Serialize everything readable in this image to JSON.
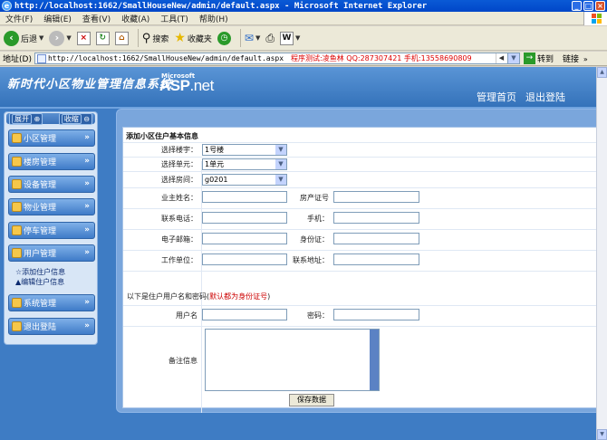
{
  "window": {
    "title": "http://localhost:1662/SmallHouseNew/admin/default.aspx - Microsoft Internet Explorer"
  },
  "menubar": [
    "文件(F)",
    "编辑(E)",
    "查看(V)",
    "收藏(A)",
    "工具(T)",
    "帮助(H)"
  ],
  "toolbar": {
    "back_label": "后退",
    "search_label": "搜索",
    "favorites_label": "收藏夹"
  },
  "address": {
    "label": "地址(D)",
    "url": "http://localhost:1662/SmallHouseNew/admin/default.aspx",
    "extra": "程序测试:凌鱼林 QQ:287307421 手机:13558690809",
    "go_label": "转到",
    "links_label": "链接"
  },
  "site": {
    "name": "新时代小区物业管理信息系统",
    "ms": "Microsoft",
    "asp": "ASP",
    "net": ".net",
    "nav": [
      "管理首页",
      "退出登陆"
    ]
  },
  "sidebar": {
    "expand_label": "展开",
    "collapse_label": "收缩",
    "items": [
      {
        "label": "小区管理"
      },
      {
        "label": "楼房管理"
      },
      {
        "label": "设备管理"
      },
      {
        "label": "物业管理"
      },
      {
        "label": "停车管理"
      },
      {
        "label": "用户管理"
      }
    ],
    "submenu": [
      "☆添加住户信息",
      "▲编辑住户信息"
    ],
    "items2": [
      {
        "label": "系统管理"
      },
      {
        "label": "退出登陆"
      }
    ]
  },
  "form": {
    "title": "添加小区住户基本信息",
    "building_label": "选择楼宇：",
    "building_value": "1号楼",
    "unit_label": "选择单元：",
    "unit_value": "1单元",
    "room_label": "选择房间：",
    "room_value": "g0201",
    "owner_label": "业主姓名：",
    "cert_label": "房产证号",
    "phone_label": "联系电话：",
    "mobile_label": "手机：",
    "email_label": "电子邮箱：",
    "id_label": "身份证：",
    "work_label": "工作单位：",
    "address_label": "联系地址：",
    "note_prefix": "以下是住户用户名和密码(",
    "note_red": "默认都为身份证号",
    "note_suffix": ")",
    "username_label": "用户名",
    "password_label": "密码：",
    "remark_label": "备注信息",
    "save_label": "保存数据"
  }
}
